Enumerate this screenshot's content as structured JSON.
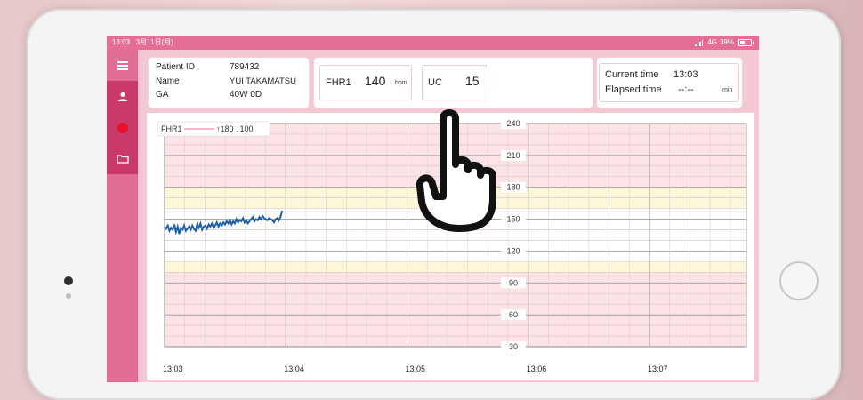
{
  "status_bar": {
    "time": "13:03",
    "date": "3月11日(月)",
    "network": "4G",
    "battery": "39%"
  },
  "sidebar": {
    "items": [
      {
        "icon": "hamburger-menu-icon"
      },
      {
        "icon": "person-icon"
      },
      {
        "icon": "record-dot-icon"
      },
      {
        "icon": "folder-icon"
      }
    ]
  },
  "patient": {
    "id_label": "Patient ID",
    "id_value": "789432",
    "name_label": "Name",
    "name_value": "YUI TAKAMATSU",
    "ga_label": "GA",
    "ga_value": "40W 0D"
  },
  "fhr": {
    "label": "FHR1",
    "value": "140",
    "unit": "bpm"
  },
  "uc": {
    "label": "UC",
    "value": "15"
  },
  "time_panel": {
    "current_label": "Current time",
    "current_value": "13:03",
    "elapsed_label": "Elapsed time",
    "elapsed_value": "--:--",
    "elapsed_unit": "min"
  },
  "chart_data": {
    "type": "line",
    "legend": {
      "series_label": "FHR1",
      "thresholds_text": "↑180 ↓100"
    },
    "y_ticks": [
      "240",
      "210",
      "180",
      "150",
      "120",
      "90",
      "60",
      "30"
    ],
    "ylim": [
      30,
      240
    ],
    "x_ticks": [
      "13:03",
      "13:04",
      "13:05",
      "13:06",
      "13:07"
    ],
    "series": [
      {
        "values": [
          143,
          141,
          144,
          139,
          142,
          140,
          145,
          138,
          143,
          136,
          142,
          140,
          144,
          139,
          141,
          143,
          140,
          144,
          141,
          139,
          145,
          142,
          146,
          140,
          143,
          144,
          141,
          145,
          143,
          146,
          142,
          144,
          147,
          143,
          146,
          144,
          147,
          145,
          148,
          146,
          149,
          145,
          148,
          146,
          150,
          147,
          149,
          148,
          151,
          147,
          149,
          146,
          148,
          150,
          152,
          148,
          150,
          149,
          152,
          150,
          153,
          151,
          150,
          149,
          151,
          150,
          149,
          147,
          150,
          151,
          149,
          152,
          158
        ]
      }
    ],
    "colors": {
      "line": "#1f5fa8",
      "alarm_band": "#fbe3e6",
      "caution_band": "#fdf6d8",
      "normal_band": "#ffffff"
    }
  }
}
